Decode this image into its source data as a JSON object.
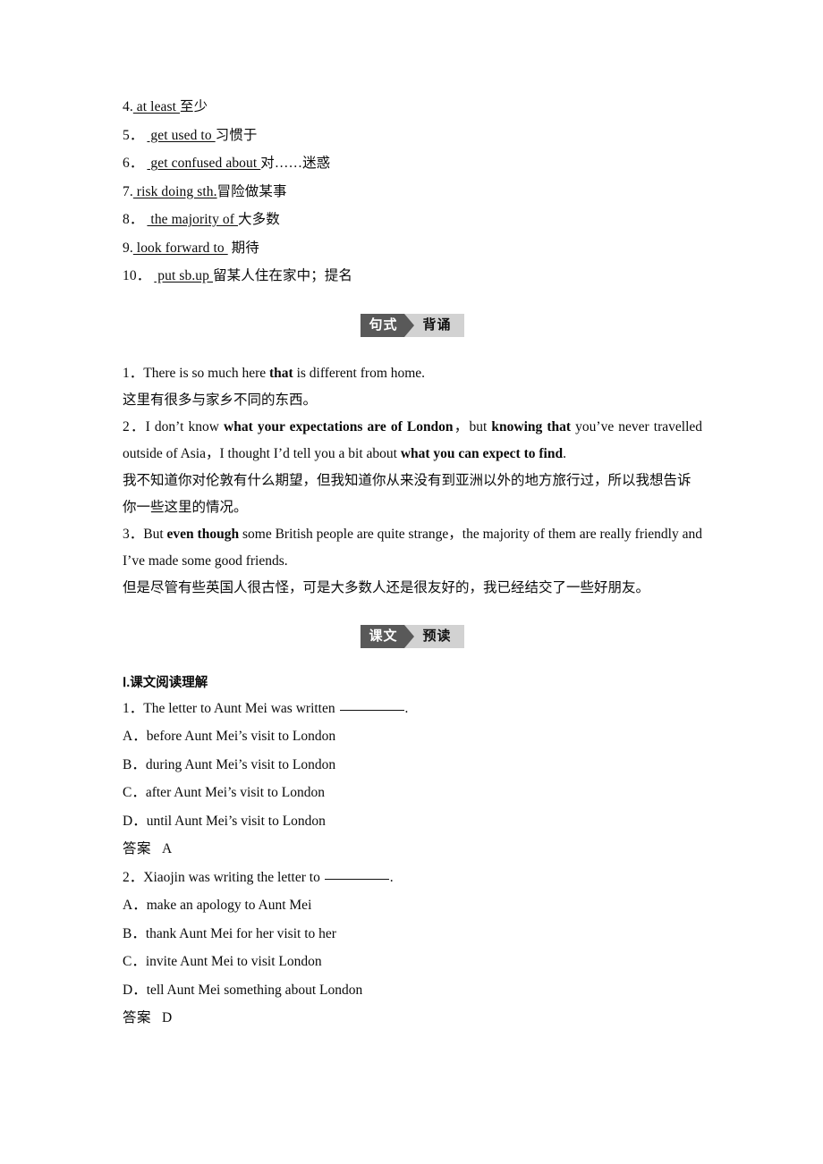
{
  "phrases": {
    "items": [
      {
        "num": "4.",
        "gap": "",
        "en": " at least ",
        "cn": "至少"
      },
      {
        "num": "5．",
        "gap": " ",
        "en": " get used to ",
        "cn": "习惯于"
      },
      {
        "num": "6．",
        "gap": " ",
        "en": " get confused about ",
        "cn": "对……迷惑"
      },
      {
        "num": "7.",
        "gap": "",
        "en": " risk doing sth.",
        "cn": "冒险做某事"
      },
      {
        "num": "8．",
        "gap": " ",
        "en": " the majority of ",
        "cn": "大多数"
      },
      {
        "num": "9.",
        "gap": "",
        "en": " look forward to ",
        "cn": " 期待"
      },
      {
        "num": "10．",
        "gap": " ",
        "en": " put sb.up ",
        "cn": "留某人住在家中；提名"
      }
    ]
  },
  "banner_sentence": {
    "dark": "句式",
    "light": "背诵"
  },
  "banner_text": {
    "dark": "课文",
    "light": "预读"
  },
  "sentences": [
    {
      "en_parts": [
        {
          "t": "1．There is so much here ",
          "b": false
        },
        {
          "t": "that",
          "b": true
        },
        {
          "t": " is different from home.",
          "b": false
        }
      ],
      "cn": "这里有很多与家乡不同的东西。"
    },
    {
      "en_parts": [
        {
          "t": "2．I don’t know ",
          "b": false
        },
        {
          "t": "what your expectations are of London",
          "b": true
        },
        {
          "t": "，but ",
          "b": false
        },
        {
          "t": "knowing that",
          "b": true
        },
        {
          "t": " you’ve never travelled outside of Asia，I thought I’d tell you a bit about ",
          "b": false
        },
        {
          "t": "what you can expect to find",
          "b": true
        },
        {
          "t": ".",
          "b": false
        }
      ],
      "cn": "我不知道你对伦敦有什么期望，但我知道你从来没有到亚洲以外的地方旅行过，所以我想告诉你一些这里的情况。"
    },
    {
      "en_parts": [
        {
          "t": "3．But ",
          "b": false
        },
        {
          "t": "even though",
          "b": true
        },
        {
          "t": " some British people are quite strange，the majority of them are really friendly and I’ve made some good friends.",
          "b": false
        }
      ],
      "cn": "但是尽管有些英国人很古怪，可是大多数人还是很友好的，我已经结交了一些好朋友。"
    }
  ],
  "reading": {
    "heading": "Ⅰ.课文阅读理解",
    "answer_label": "答案",
    "questions": [
      {
        "stem_pre": "1．The letter to Aunt Mei was written ",
        "stem_post": ".",
        "options": [
          "A．before Aunt Mei’s visit to London",
          "B．during Aunt Mei’s visit to London",
          "C．after Aunt Mei’s visit to London",
          "D．until Aunt Mei’s visit to London"
        ],
        "answer": "A"
      },
      {
        "stem_pre": "2．Xiaojin was writing the letter to ",
        "stem_post": ".",
        "options": [
          "A．make an apology to Aunt Mei",
          "B．thank Aunt Mei for her visit to her",
          "C．invite Aunt Mei to visit London",
          "D．tell Aunt Mei something about London"
        ],
        "answer": "D"
      }
    ]
  }
}
